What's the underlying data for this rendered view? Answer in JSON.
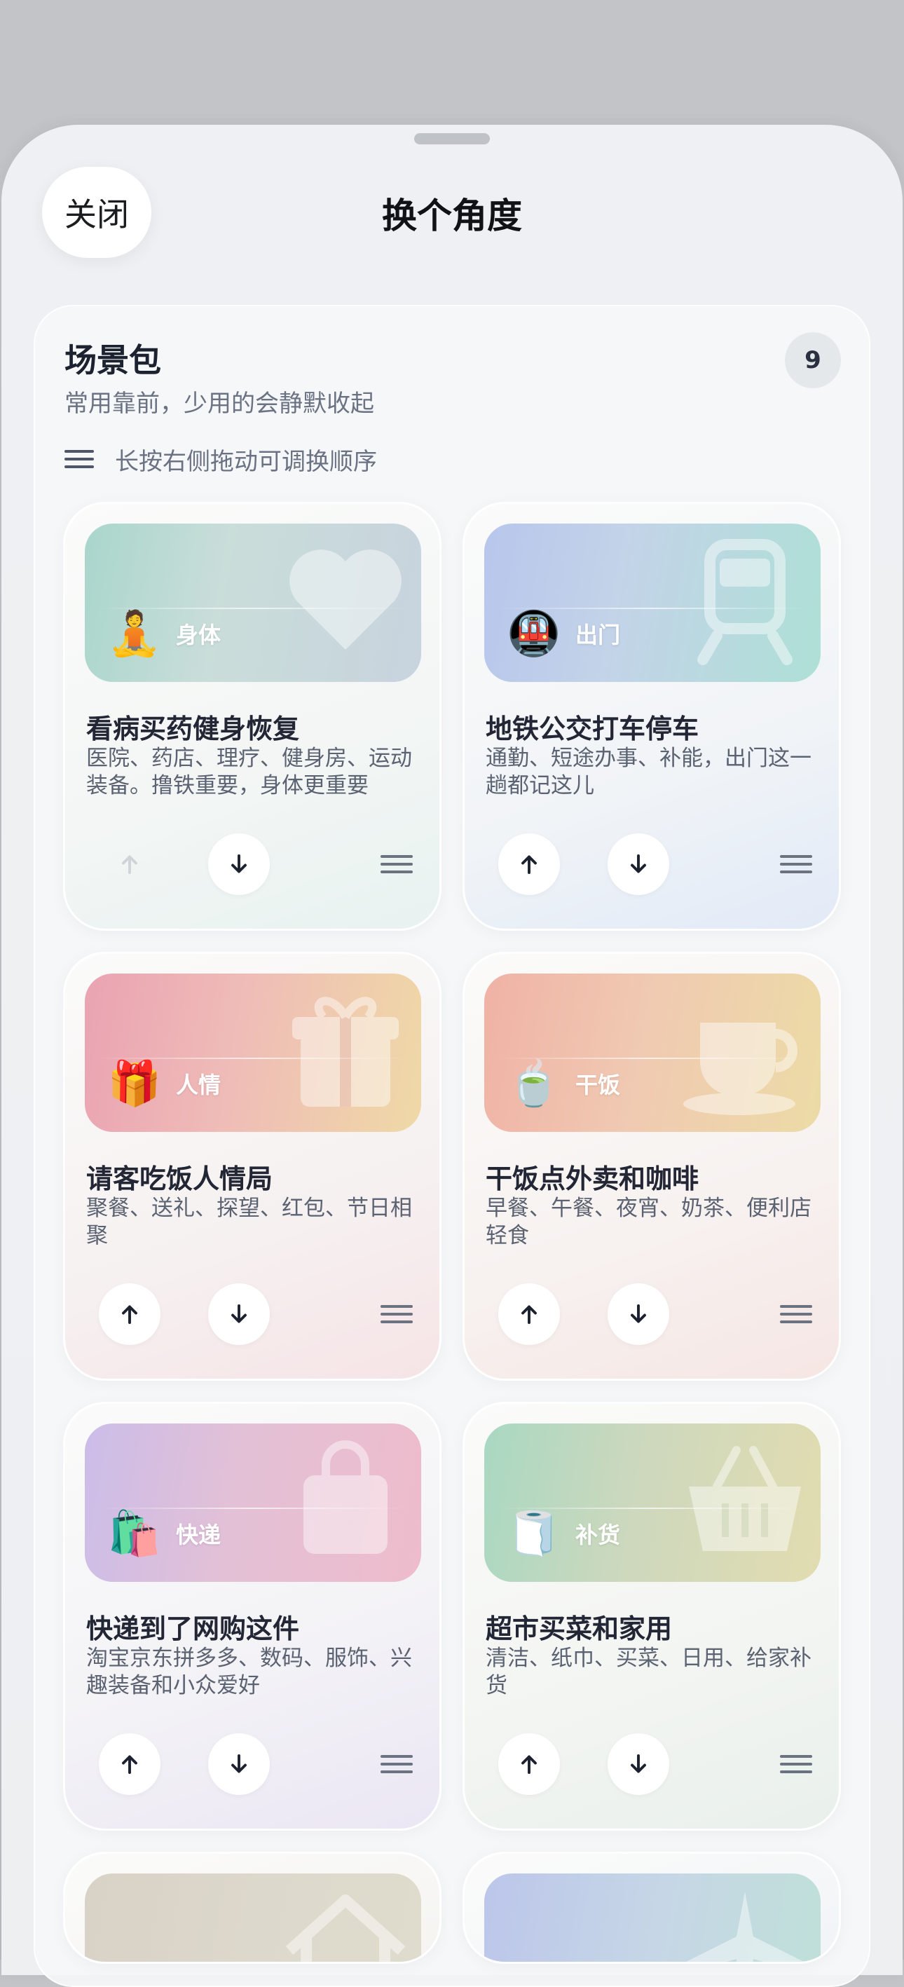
{
  "sheet": {
    "title": "换个角度",
    "close_label": "关闭"
  },
  "section": {
    "title": "场景包",
    "subtitle": "常用靠前，少用的会静默收起",
    "count": "9",
    "hint": "长按右侧拖动可调换顺序"
  },
  "cards": [
    {
      "tag": "身体",
      "emoji": "🧘",
      "title": "看病买药健身恢复",
      "desc": "医院、药店、理疗、健身房、运动装备。撸铁重要，身体更重要",
      "up_enabled": false,
      "deco": "heart-icon"
    },
    {
      "tag": "出门",
      "emoji": "🚇",
      "title": "地铁公交打车停车",
      "desc": "通勤、短途办事、补能，出门这一趟都记这儿",
      "up_enabled": true,
      "deco": "train-icon"
    },
    {
      "tag": "人情",
      "emoji": "🎁",
      "title": "请客吃饭人情局",
      "desc": "聚餐、送礼、探望、红包、节日相聚",
      "up_enabled": true,
      "deco": "gift-icon"
    },
    {
      "tag": "干饭",
      "emoji": "🍵",
      "title": "干饭点外卖和咖啡",
      "desc": "早餐、午餐、夜宵、奶茶、便利店轻食",
      "up_enabled": true,
      "deco": "coffee-cup-icon"
    },
    {
      "tag": "快递",
      "emoji": "🛍️",
      "title": "快递到了网购这件",
      "desc": "淘宝京东拼多多、数码、服饰、兴趣装备和小众爱好",
      "up_enabled": true,
      "deco": "shopping-bag-icon"
    },
    {
      "tag": "补货",
      "emoji": "🧻",
      "title": "超市买菜和家用",
      "desc": "清洁、纸巾、买菜、日用、给家补货",
      "up_enabled": true,
      "deco": "basket-icon"
    }
  ],
  "colors": {
    "sheet_bg": "#eef0f3",
    "text_primary": "#1d2230",
    "text_secondary": "#6a7283"
  }
}
